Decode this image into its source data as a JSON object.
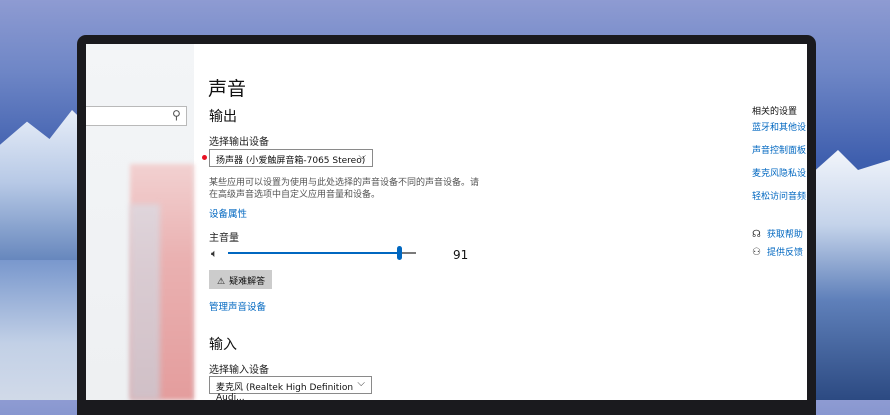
{
  "page": {
    "title": "声音",
    "output_header": "输出",
    "input_header": "输入"
  },
  "output": {
    "device_label": "选择输出设备",
    "device_value": "扬声器 (小爱触屏音箱-7065 Stereo)",
    "description": "某些应用可以设置为使用与此处选择的声音设备不同的声音设备。请在高级声音选项中自定义应用音量和设备。",
    "device_properties_link": "设备属性",
    "master_volume_label": "主音量",
    "volume_value": "91",
    "volume_level": 0.91,
    "troubleshoot_label": "疑难解答",
    "manage_devices_link": "管理声音设备"
  },
  "input": {
    "device_label": "选择输入设备",
    "device_value": "麦克风 (Realtek High Definition Audi..."
  },
  "related": {
    "title": "相关的设置",
    "links": [
      "蓝牙和其他设",
      "声音控制面板",
      "麦克风隐私设",
      "轻松访问音频"
    ],
    "help": "获取帮助",
    "feedback": "提供反馈"
  },
  "icons": {
    "search": "search-icon",
    "speaker": "speaker-icon",
    "warning": "warning-icon",
    "chevron": "chevron-down-icon",
    "help": "help-icon",
    "feedback": "feedback-icon"
  },
  "colors": {
    "accent": "#0067c0",
    "status_dot": "#e81123"
  }
}
